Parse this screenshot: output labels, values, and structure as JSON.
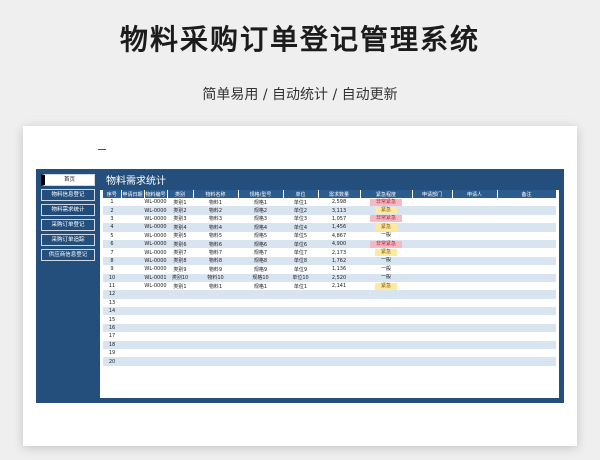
{
  "hero": {
    "title": "物料采购订单登记管理系统",
    "subtitle": "简单易用 / 自动统计 / 自动更新"
  },
  "sidebar": {
    "items": [
      {
        "label": "首页"
      },
      {
        "label": "物料信息登记"
      },
      {
        "label": "物料需求统计"
      },
      {
        "label": "采购订单登记"
      },
      {
        "label": "采购订单追踪"
      },
      {
        "label": "供应商信息登记"
      }
    ]
  },
  "panel": {
    "title": "物料需求统计"
  },
  "table": {
    "columns": [
      "序号",
      "申请日期",
      "物料编号",
      "类别",
      "物料名称",
      "规格/型号",
      "单位",
      "需求数量",
      "紧急程度",
      "申请部门",
      "申请人",
      "备注"
    ],
    "rows": [
      {
        "no": "1",
        "date": "",
        "code": "WL-0000",
        "cat": "类别1",
        "name": "物料1",
        "spec": "规格1",
        "unit": "单位1",
        "qty": "2,598",
        "urgency": "非常紧急",
        "dept": "",
        "person": "",
        "note": ""
      },
      {
        "no": "2",
        "date": "",
        "code": "WL-0000",
        "cat": "类别2",
        "name": "物料2",
        "spec": "规格2",
        "unit": "单位2",
        "qty": "3,113",
        "urgency": "紧急",
        "dept": "",
        "person": "",
        "note": ""
      },
      {
        "no": "3",
        "date": "",
        "code": "WL-0000",
        "cat": "类别3",
        "name": "物料3",
        "spec": "规格3",
        "unit": "单位3",
        "qty": "1,057",
        "urgency": "非常紧急",
        "dept": "",
        "person": "",
        "note": ""
      },
      {
        "no": "4",
        "date": "",
        "code": "WL-0000",
        "cat": "类别4",
        "name": "物料4",
        "spec": "规格4",
        "unit": "单位4",
        "qty": "1,456",
        "urgency": "紧急",
        "dept": "",
        "person": "",
        "note": ""
      },
      {
        "no": "5",
        "date": "",
        "code": "WL-0000",
        "cat": "类别5",
        "name": "物料5",
        "spec": "规格5",
        "unit": "单位5",
        "qty": "4,867",
        "urgency": "一般",
        "dept": "",
        "person": "",
        "note": ""
      },
      {
        "no": "6",
        "date": "",
        "code": "WL-0000",
        "cat": "类别6",
        "name": "物料6",
        "spec": "规格6",
        "unit": "单位6",
        "qty": "4,900",
        "urgency": "非常紧急",
        "dept": "",
        "person": "",
        "note": ""
      },
      {
        "no": "7",
        "date": "",
        "code": "WL-0000",
        "cat": "类别7",
        "name": "物料7",
        "spec": "规格7",
        "unit": "单位7",
        "qty": "2,173",
        "urgency": "紧急",
        "dept": "",
        "person": "",
        "note": ""
      },
      {
        "no": "8",
        "date": "",
        "code": "WL-0000",
        "cat": "类别8",
        "name": "物料8",
        "spec": "规格8",
        "unit": "单位8",
        "qty": "1,762",
        "urgency": "一般",
        "dept": "",
        "person": "",
        "note": ""
      },
      {
        "no": "9",
        "date": "",
        "code": "WL-0000",
        "cat": "类别9",
        "name": "物料9",
        "spec": "规格9",
        "unit": "单位9",
        "qty": "1,136",
        "urgency": "一般",
        "dept": "",
        "person": "",
        "note": ""
      },
      {
        "no": "10",
        "date": "",
        "code": "WL-0001",
        "cat": "类别10",
        "name": "物料10",
        "spec": "规格10",
        "unit": "单位10",
        "qty": "2,520",
        "urgency": "一般",
        "dept": "",
        "person": "",
        "note": ""
      },
      {
        "no": "11",
        "date": "",
        "code": "WL-0000",
        "cat": "类别1",
        "name": "物料1",
        "spec": "规格1",
        "unit": "单位1",
        "qty": "2,141",
        "urgency": "紧急",
        "dept": "",
        "person": "",
        "note": ""
      },
      {
        "no": "12"
      },
      {
        "no": "13"
      },
      {
        "no": "14"
      },
      {
        "no": "15"
      },
      {
        "no": "16"
      },
      {
        "no": "17"
      },
      {
        "no": "18"
      },
      {
        "no": "19"
      },
      {
        "no": "20"
      }
    ]
  },
  "colors": {
    "frame": "#244f7d",
    "header": "#2c5b8d",
    "stripe": "#d9e4f1",
    "urgent_red": "#f4b9c1",
    "urgent_yellow": "#ffe9a0"
  }
}
